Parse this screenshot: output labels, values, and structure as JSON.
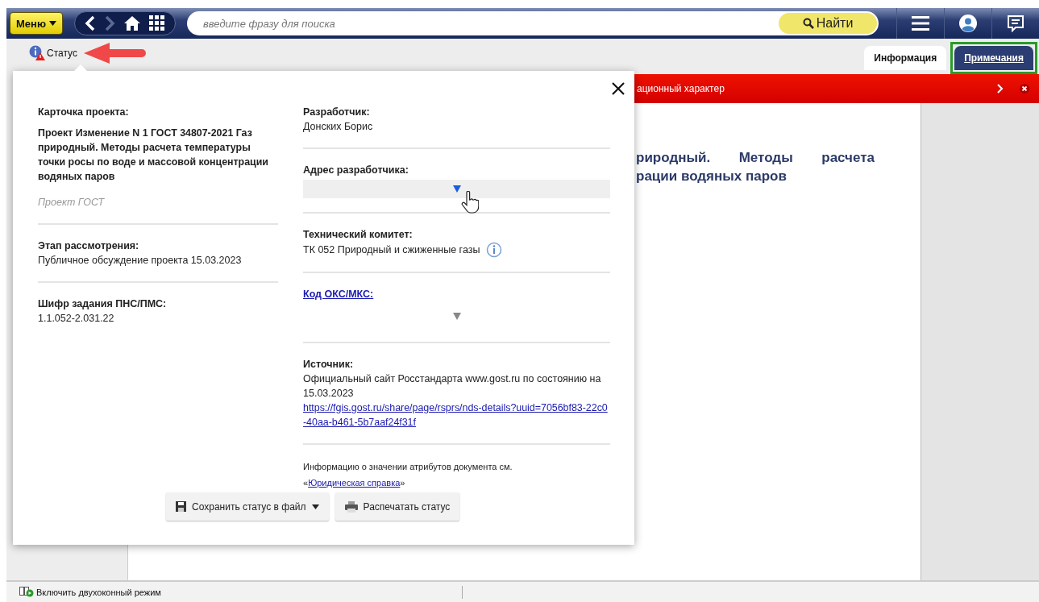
{
  "toolbar": {
    "menu_button": "Меню",
    "forward_disabled": true,
    "search": {
      "placeholder": "введите фразу для поиска"
    },
    "find_button": "Найти"
  },
  "subbar": {
    "status_link": "Статус"
  },
  "tabs": [
    {
      "label": "Информация",
      "selected": true,
      "highlighted": false
    },
    {
      "label": "Примечания",
      "selected": false,
      "highlighted": true
    }
  ],
  "document": {
    "banner": "ационный характер",
    "heading_lines": [
      "риродный. Методы расчета",
      "рации водяных паров"
    ]
  },
  "status_dialog": {
    "left": [
      {
        "label": "Карточка проекта:",
        "title": "Проект Изменение N 1 ГОСТ 34807-2021 Газ природный. Методы расчета температуры точки росы по воде и массовой концентрации водяных паров",
        "note": "Проект ГОСТ"
      },
      {
        "label": "Этап рассмотрения:",
        "value": "Публичное обсуждение проекта 15.03.2023"
      },
      {
        "label": "Шифр задания ПНС/ПМС:",
        "value": "1.1.052-2.031.22"
      }
    ],
    "right": [
      {
        "kind": "text",
        "label": "Разработчик:",
        "value": "Донских Борис"
      },
      {
        "kind": "expander",
        "label": "Адрес разработчика:",
        "highlighted": true
      },
      {
        "kind": "info",
        "label": "Технический комитет:",
        "value": "ТК 052 Природный и сжиженные газы"
      },
      {
        "kind": "link_expander",
        "label": "Код ОКС/МКС:",
        "highlighted": false
      },
      {
        "kind": "source",
        "label": "Источник:",
        "value": "Официальный сайт Росстандарта www.gost.ru по состоянию на 15.03.2023",
        "link": "https://fgis.gost.ru/share/page/rsprs/nds-details?uuid=7056bf83-22c0-40aa-b461-5b7aaf24f31f"
      }
    ],
    "footnote": {
      "text": "Информацию о значении атрибутов документа см.",
      "quote_open": "«",
      "link": "Юридическая справка",
      "quote_close": "»"
    },
    "buttons": [
      {
        "label": "Сохранить статус в файл",
        "has_menu": true
      },
      {
        "label": "Распечатать статус",
        "has_menu": false
      }
    ]
  },
  "status_bar": {
    "two_window_label": "Включить двухоконный режим"
  }
}
